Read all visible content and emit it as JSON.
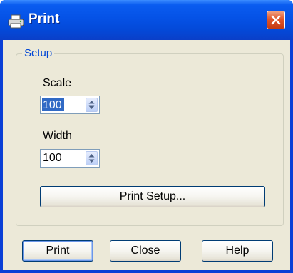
{
  "window": {
    "title": "Print",
    "icon": "printer-icon",
    "close_icon": "close-icon"
  },
  "setup_group": {
    "legend": "Setup",
    "scale": {
      "label": "Scale",
      "value": "100"
    },
    "width": {
      "label": "Width",
      "value": "100"
    },
    "print_setup_label": "Print Setup..."
  },
  "footer": {
    "print_label": "Print",
    "close_label": "Close",
    "help_label": "Help"
  },
  "colors": {
    "titlebar": "#0552e6",
    "client_bg": "#ece9d8",
    "group_legend": "#0046d5",
    "close_button": "#e0552a",
    "selection": "#316ac5"
  }
}
